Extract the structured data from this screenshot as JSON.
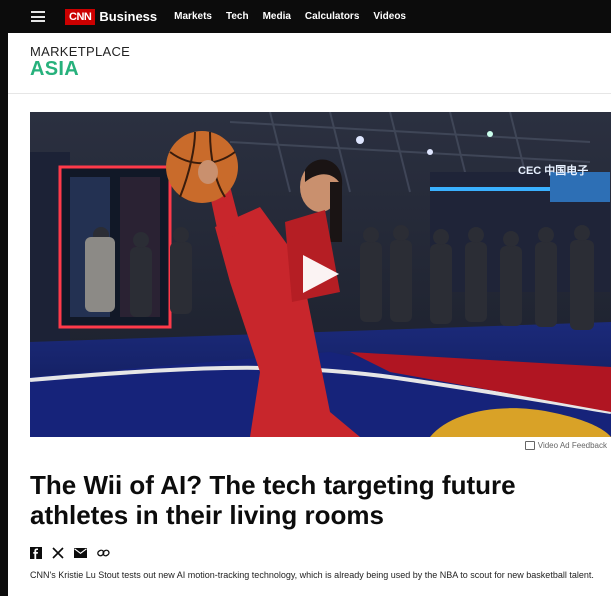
{
  "nav": {
    "brand_logo": "CNN",
    "brand_word": "Business",
    "links": [
      "Markets",
      "Tech",
      "Media",
      "Calculators",
      "Videos"
    ]
  },
  "section": {
    "line1": "MARKETPLACE",
    "line2": "ASIA"
  },
  "video": {
    "scene_sign": "CEC 中国电子",
    "feedback": "Video Ad Feedback"
  },
  "article": {
    "headline": "The Wii of AI? The tech targeting future athletes in their living rooms",
    "caption": "CNN's Kristie Lu Stout tests out new AI motion-tracking technology, which is already being used by the NBA to scout for new basketball talent."
  },
  "share_icons": [
    "facebook-icon",
    "x-icon",
    "email-icon",
    "link-icon"
  ],
  "colors": {
    "brand_red": "#cc0000",
    "section_green": "#27b17c",
    "nav_bg": "#0c0c0c"
  }
}
